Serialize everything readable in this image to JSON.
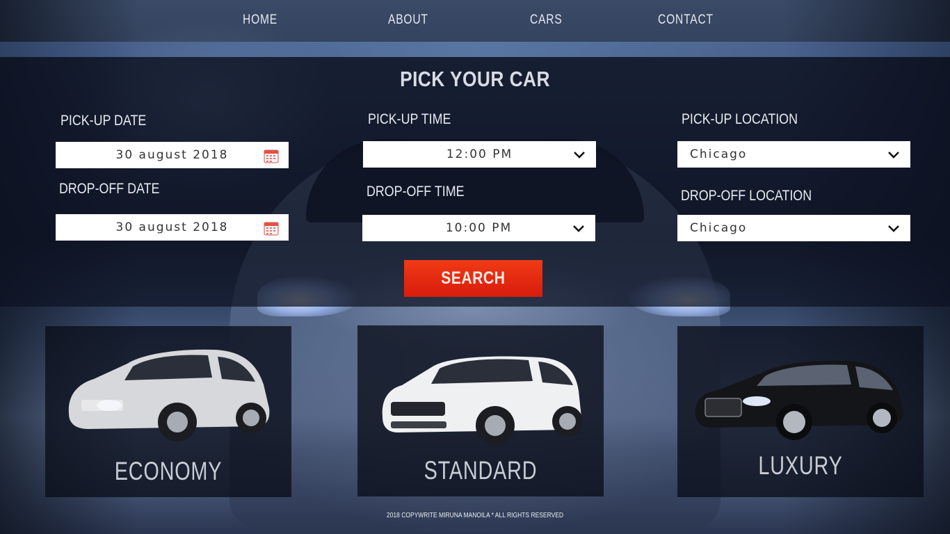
{
  "nav": {
    "items": [
      {
        "label": "HOME"
      },
      {
        "label": "ABOUT"
      },
      {
        "label": "CARS"
      },
      {
        "label": "CONTACT"
      }
    ]
  },
  "booking": {
    "title": "PICK YOUR CAR",
    "pickup_date": {
      "label": "PICK-UP DATE",
      "value": "30 august 2018"
    },
    "dropoff_date": {
      "label": "DROP-OFF DATE",
      "value": "30 august 2018"
    },
    "pickup_time": {
      "label": "PICK-UP TIME",
      "value": "12:00 PM"
    },
    "dropoff_time": {
      "label": "DROP-OFF TIME",
      "value": "10:00 PM"
    },
    "pickup_location": {
      "label": "PICK-UP LOCATION",
      "value": "Chicago"
    },
    "dropoff_location": {
      "label": "DROP-OFF LOCATION",
      "value": "Chicago"
    },
    "search_label": "SEARCH"
  },
  "categories": [
    {
      "label": "ECONOMY",
      "car_color": "#d8dadd"
    },
    {
      "label": "STANDARD",
      "car_color": "#eef0f2"
    },
    {
      "label": "LUXURY",
      "car_color": "#141518"
    }
  ],
  "footer": {
    "text": "2018 COPYWRITE MIRUNA MANOILA * ALL RIGHTS RESERVED"
  },
  "colors": {
    "accent": "#e02a10",
    "panel": "#0c1222"
  },
  "icons": {
    "date": "calendar-icon",
    "dropdown": "chevron-down-icon"
  }
}
